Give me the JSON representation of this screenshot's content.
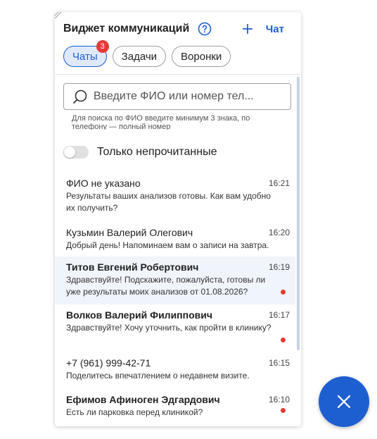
{
  "header": {
    "title": "Виджет коммуникаций",
    "chat_button": "Чат"
  },
  "tabs": [
    {
      "label": "Чаты",
      "badge": "3"
    },
    {
      "label": "Задачи"
    },
    {
      "label": "Воронки"
    }
  ],
  "search": {
    "placeholder": "Введите ФИО или номер тел...",
    "hint": "Для поиска по ФИО введите минимум 3 знака, по телефону — полный номер"
  },
  "filter": {
    "label": "Только непрочитанные",
    "on": false
  },
  "chats": [
    {
      "name": "ФИО не указано",
      "time": "16:21",
      "message": "Результаты ваших анализов готовы. Как вам удобно их получить?",
      "unread": false
    },
    {
      "name": "Кузьмин Валерий Олегович",
      "time": "16:20",
      "message": "Добрый день! Напоминаем вам о записи на завтра.",
      "unread": false
    },
    {
      "name": "Титов Евгений Робертович",
      "time": "16:19",
      "message": "Здравствуйте! Подскажите, пожалуйста, готовы ли уже результаты моих анализов от 01.08.2026?",
      "unread": true
    },
    {
      "name": "Волков Валерий Филиппович",
      "time": "16:17",
      "message": "Здравствуйте! Хочу уточнить, как пройти в клинику?",
      "unread": true
    },
    {
      "name": "+7 (961) 999-42-71",
      "time": "16:15",
      "message": "Поделитесь впечатлением о недавнем визите.",
      "unread": false
    },
    {
      "name": "Ефимов Афиноген Эдгардович",
      "time": "16:10",
      "message": "Есть ли парковка перед клиникой?",
      "unread": true
    }
  ],
  "colors": {
    "accent": "#1e5fd0",
    "badge": "#e53935",
    "active_tab_bg": "#dfe9fb"
  }
}
